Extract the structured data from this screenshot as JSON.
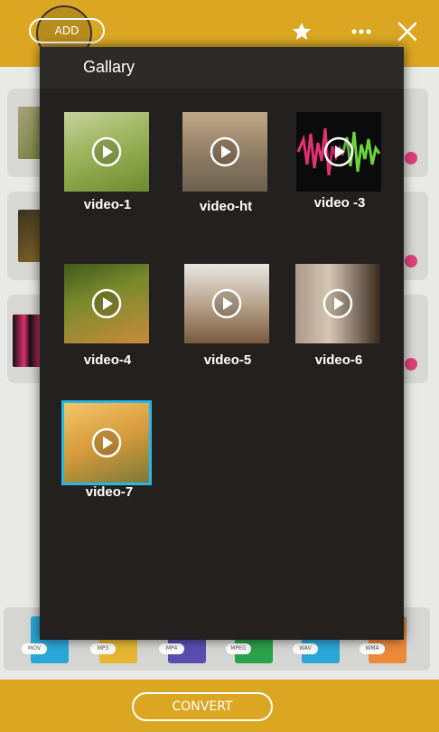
{
  "topbar": {
    "add_label": "ADD"
  },
  "gallery": {
    "title": "Gallary",
    "videos": [
      {
        "label": "video-1"
      },
      {
        "label": "video-ht"
      },
      {
        "label": "video -3"
      },
      {
        "label": "video-4"
      },
      {
        "label": "video-5"
      },
      {
        "label": "video-6"
      },
      {
        "label": "video-7"
      }
    ]
  },
  "formats": [
    "MOV",
    "MP3",
    "MP4",
    "MPEG",
    "WAV",
    "WMA"
  ],
  "footer": {
    "convert_label": "CONVERT"
  },
  "colors": {
    "accent": "#dba722",
    "overlay": "#232120",
    "selection": "#29b6e6",
    "badge": "#e0407c"
  }
}
